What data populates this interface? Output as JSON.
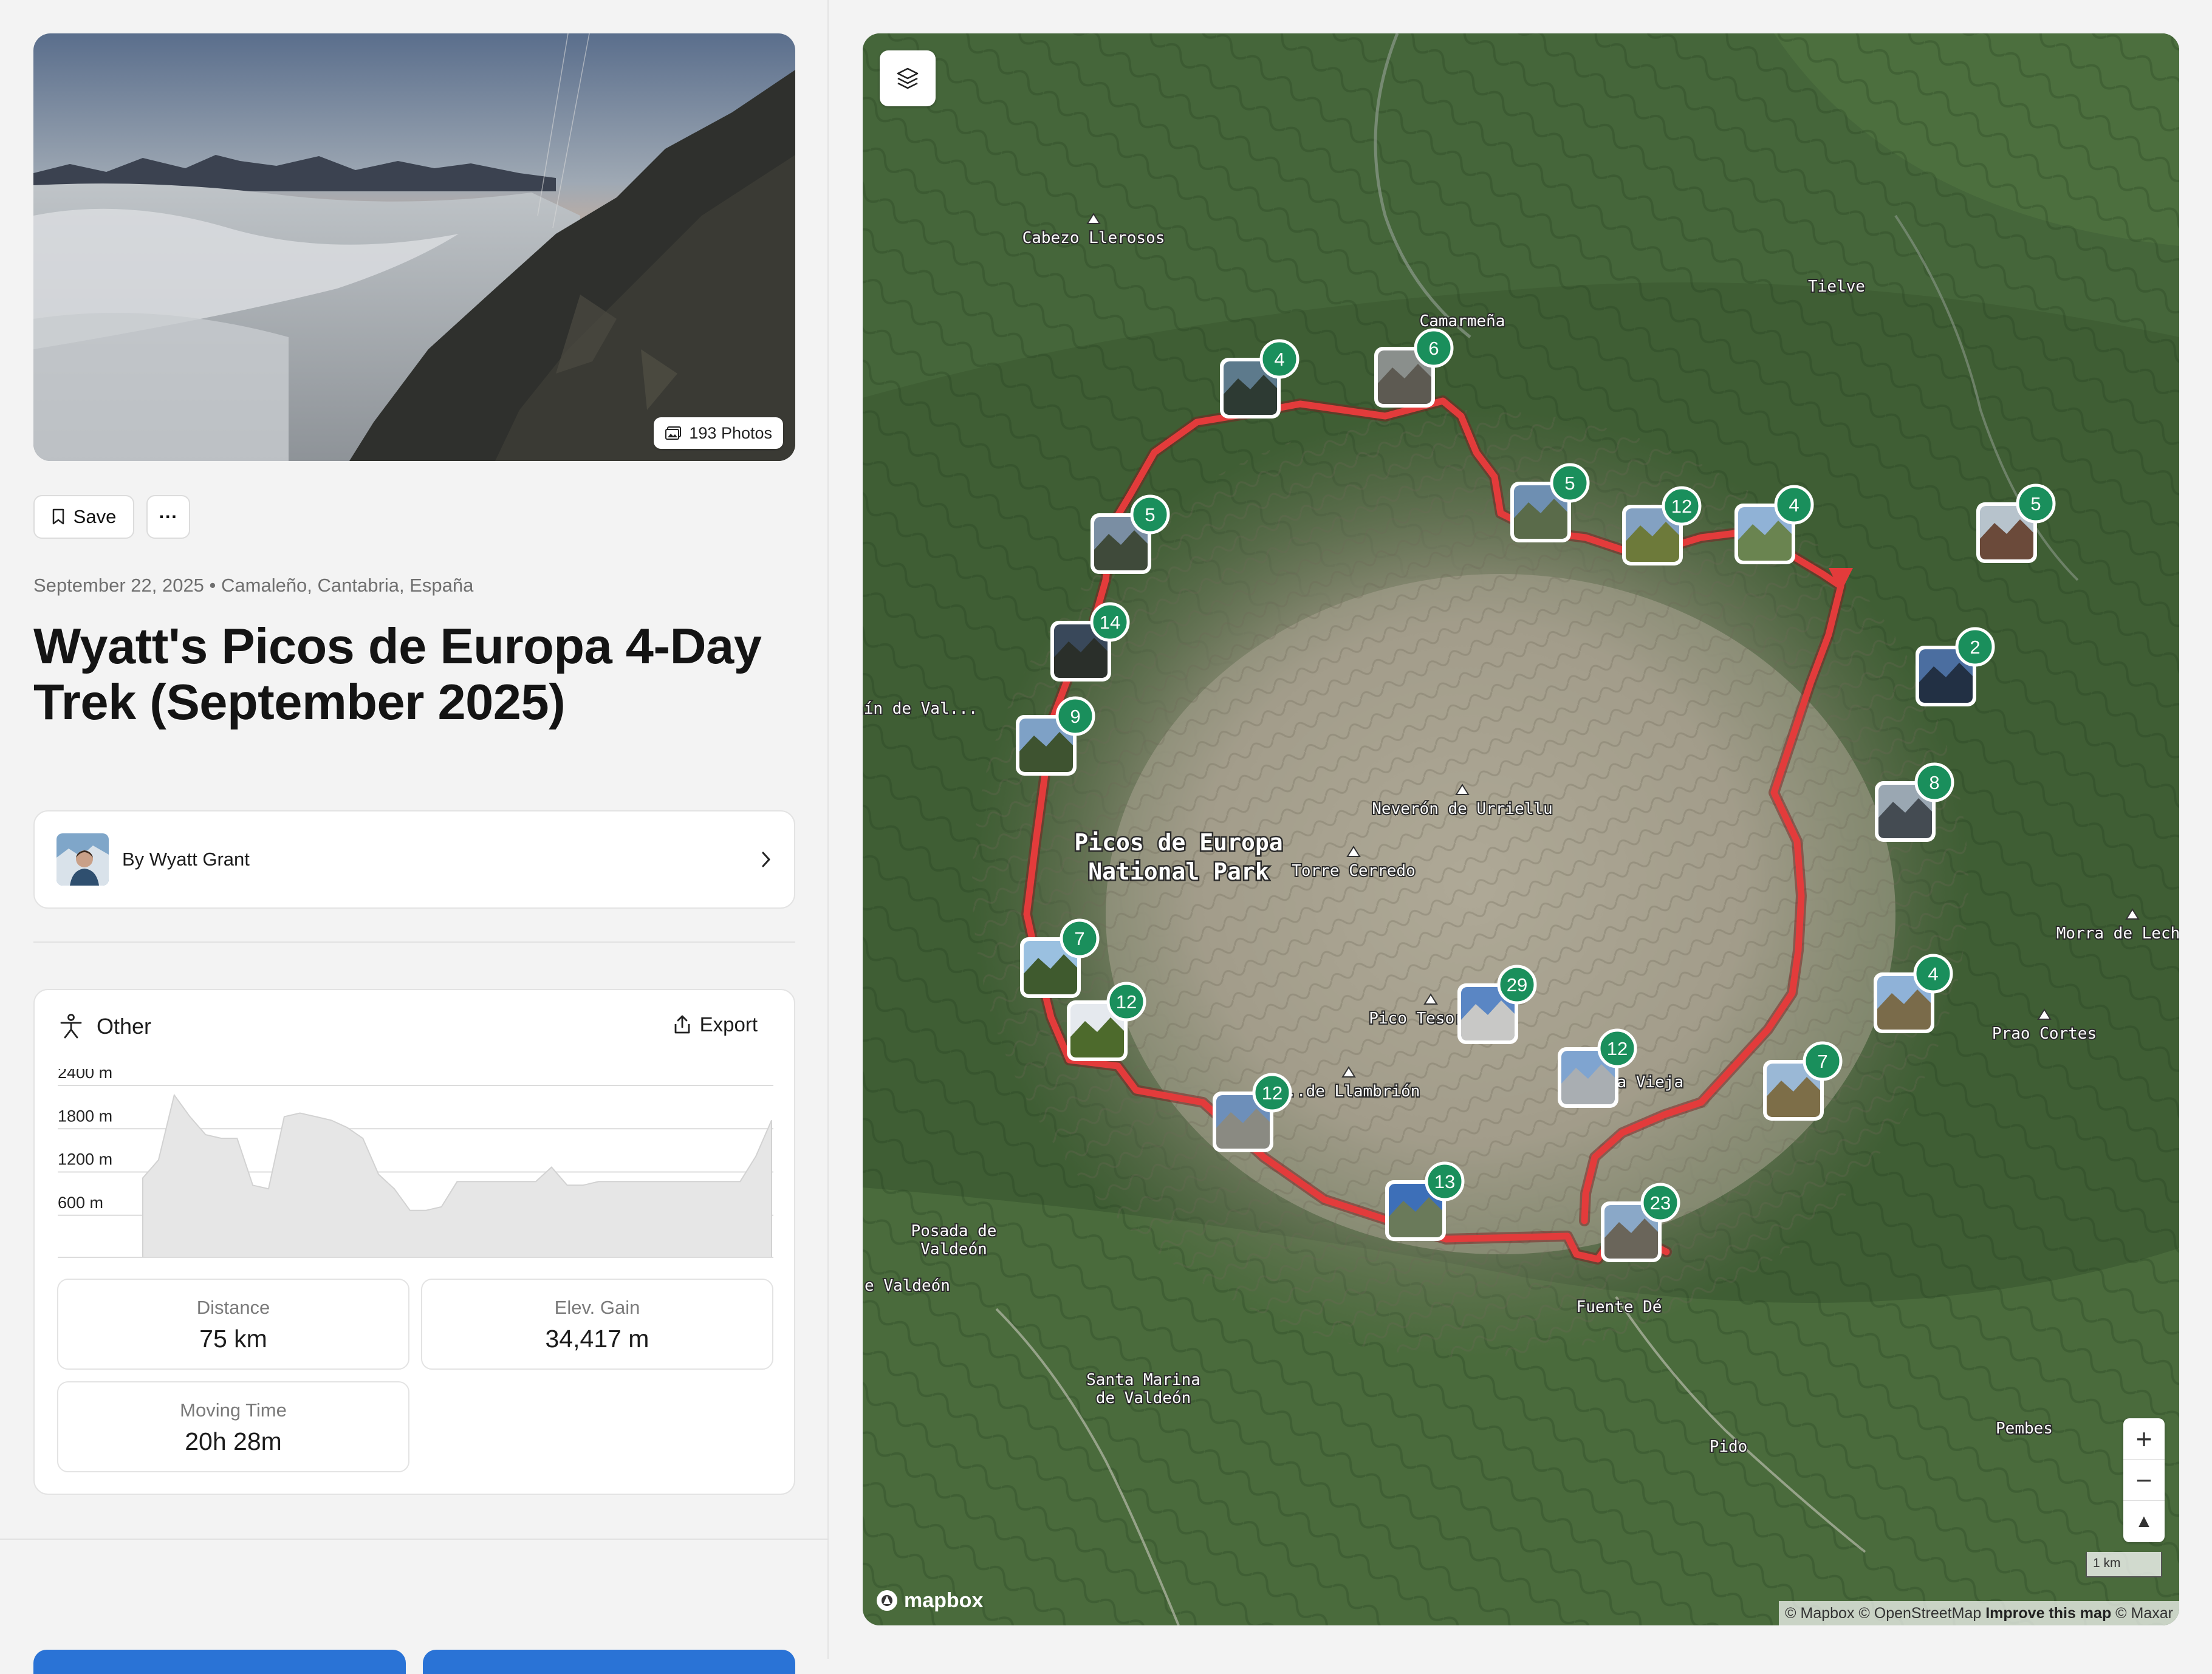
{
  "hero": {
    "photos_label": "193 Photos"
  },
  "actions": {
    "save_label": "Save",
    "more_label": "···"
  },
  "meta": {
    "date_location": "September 22, 2025 • Camaleño, Cantabria, España"
  },
  "title": "Wyatt's Picos de Europa 4-Day Trek (September 2025)",
  "author": {
    "label": "By Wyatt Grant"
  },
  "activity": {
    "type": "Other",
    "export_label": "Export"
  },
  "chart_data": {
    "type": "area",
    "title": "",
    "xlabel": "",
    "ylabel": "",
    "y_ticks": [
      "2400 m",
      "1800 m",
      "1200 m",
      "600 m"
    ],
    "ylim": [
      0,
      2400
    ],
    "grid": true,
    "color": "#e6e6e6",
    "series": [
      {
        "values": [
          1100,
          1350,
          2250,
          1950,
          1700,
          1650,
          1650,
          1000,
          950,
          1950,
          2000,
          1950,
          1900,
          1800,
          1650,
          1150,
          950,
          650,
          650,
          700,
          1050,
          1050,
          1050,
          1050,
          1050,
          1050,
          1250,
          1000,
          1000,
          1050,
          1050,
          1050,
          1050,
          1050,
          1050,
          1050,
          1050,
          1050,
          1050,
          1400,
          1900
        ]
      }
    ]
  },
  "stats": [
    {
      "label": "Distance",
      "value": "75 km"
    },
    {
      "label": "Elev. Gain",
      "value": "34,417 m"
    },
    {
      "label": "Moving Time",
      "value": "20h 28m"
    }
  ],
  "map": {
    "labels": [
      "Cabezo Llerosos",
      "Camarmeña",
      "Tielve",
      "Caín de Val...",
      "Picos de Europa",
      "National Park",
      "Neverón de Urriellu",
      "Torre Cerredo",
      "Morra de Lechuga",
      "Prao Cortes",
      "Pico Tesor...",
      "...de Llambrión",
      "...na Vieja",
      "Posada de",
      "Valdeón",
      "...e Valdeón",
      "Fuente Dé",
      "Santa Marina",
      "de Valdeón",
      "Pido",
      "Pembes"
    ],
    "markers": [
      "4",
      "6",
      "5",
      "12",
      "4",
      "5",
      "5",
      "14",
      "9",
      "2",
      "8",
      "7",
      "12",
      "4",
      "12",
      "29",
      "12",
      "7",
      "13",
      "23"
    ],
    "zoom_in": "+",
    "zoom_out": "−",
    "compass": "▲",
    "scale": "1 km",
    "logo": "mapbox",
    "attribution_1": "© Mapbox © OpenStreetMap",
    "attribution_2": "Improve this map",
    "attribution_3": "© Maxar"
  },
  "colors": {
    "route": "#e33b3b",
    "marker": "#1a8f5c",
    "primary_button": "#2a73d6"
  }
}
